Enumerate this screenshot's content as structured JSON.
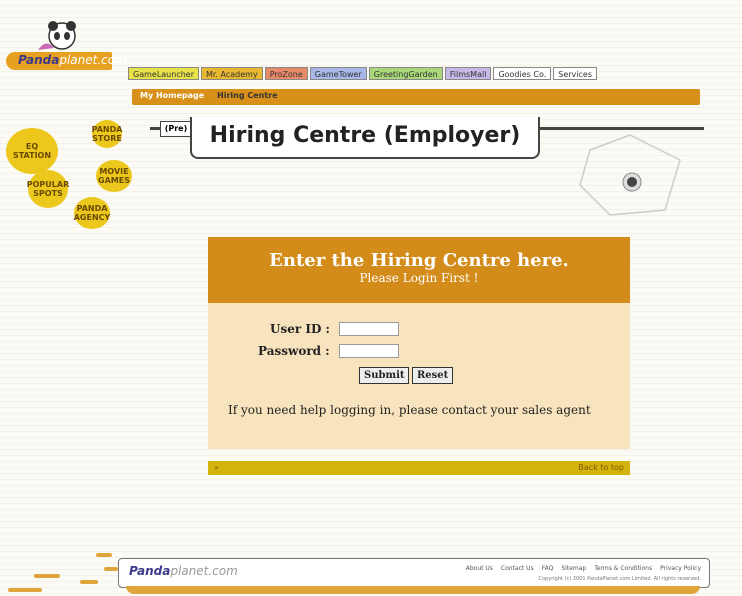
{
  "logo": {
    "brand": "Panda",
    "suffix": "planet.com"
  },
  "nav": {
    "tabs": [
      {
        "label": "GameLauncher",
        "color": "#e8e24a"
      },
      {
        "label": "Mr. Academy",
        "color": "#e8b830"
      },
      {
        "label": "ProZone",
        "color": "#e88a6a"
      },
      {
        "label": "GameTower",
        "color": "#a8b8e8"
      },
      {
        "label": "GreetingGarden",
        "color": "#a8d878"
      },
      {
        "label": "FilmsMall",
        "color": "#c8b8e8"
      },
      {
        "label": "Goodies Co.",
        "color": "#ffffff"
      },
      {
        "label": "Services",
        "color": "#ffffff"
      }
    ]
  },
  "breadcrumb": {
    "home": "My Homepage",
    "current": "Hiring Centre"
  },
  "page": {
    "ticket": "(Pre)",
    "title": "Hiring Centre (Employer)"
  },
  "side": {
    "bubbles": [
      "EQ STATION",
      "PANDA STORE",
      "POPULAR SPOTS",
      "MOVIE GAMES",
      "PANDA AGENCY"
    ]
  },
  "login": {
    "heading": "Enter the Hiring Centre here.",
    "subheading": "Please Login First !",
    "user_label": "User ID :",
    "password_label": "Password :",
    "user_value": "",
    "password_value": "",
    "submit": "Submit",
    "reset": "Reset",
    "help": "If you need help logging in, please contact your sales agent"
  },
  "bar": {
    "left": "»",
    "right": "Back to top"
  },
  "footer": {
    "brand": "Panda",
    "suffix": "planet.com",
    "links": [
      "About Us",
      "Contact Us",
      "FAQ",
      "Sitemap",
      "Terms & Conditions",
      "Privacy Policy"
    ],
    "copyright": "Copyright (c) 2001 PandaPlanet.com Limited. All rights reserved."
  }
}
